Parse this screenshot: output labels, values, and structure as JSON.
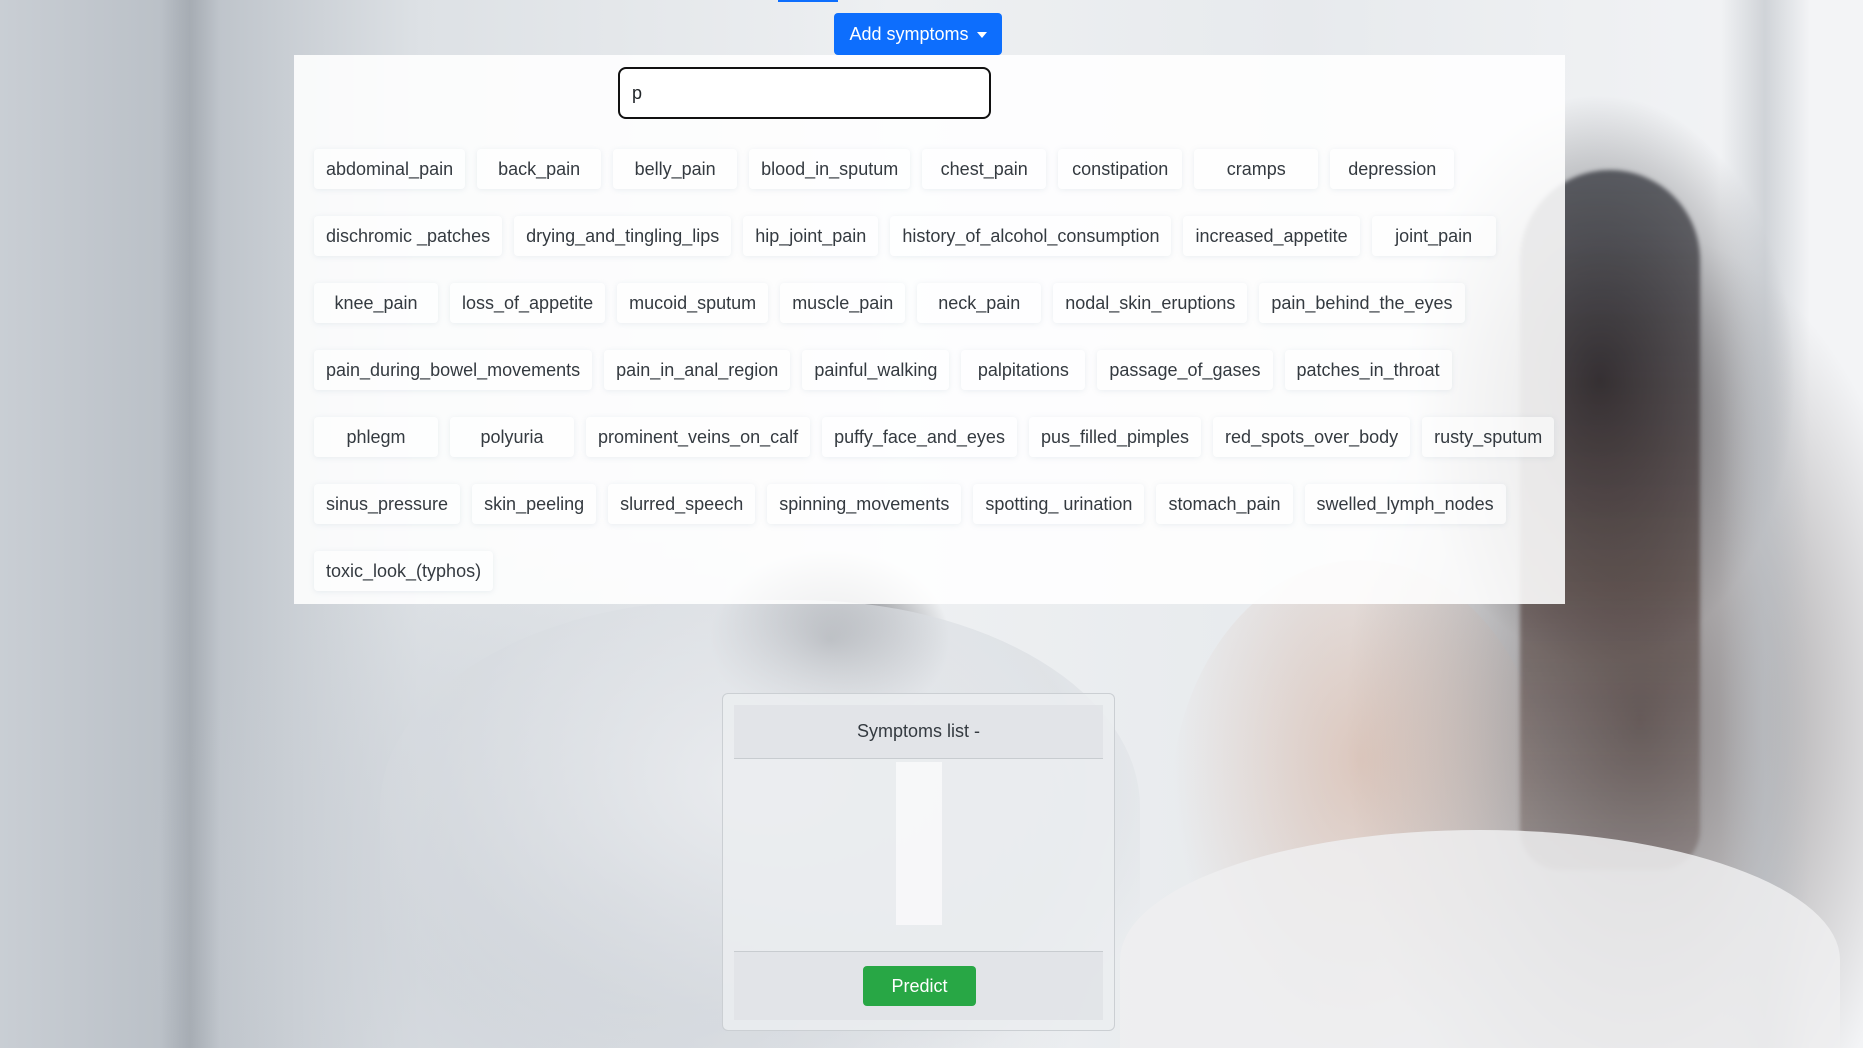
{
  "dropdown": {
    "toggle_label": "Add symptoms",
    "search_value": "p",
    "search_placeholder": "",
    "chip_rows": [
      [
        "abdominal_pain",
        "back_pain",
        "belly_pain",
        "blood_in_sputum",
        "chest_pain",
        "constipation",
        "cramps",
        "depression"
      ],
      [
        "dischromic _patches",
        "drying_and_tingling_lips",
        "hip_joint_pain",
        "history_of_alcohol_consumption",
        "increased_appetite",
        "joint_pain"
      ],
      [
        "knee_pain",
        "loss_of_appetite",
        "mucoid_sputum",
        "muscle_pain",
        "neck_pain",
        "nodal_skin_eruptions",
        "pain_behind_the_eyes"
      ],
      [
        "pain_during_bowel_movements",
        "pain_in_anal_region",
        "painful_walking",
        "palpitations",
        "passage_of_gases",
        "patches_in_throat"
      ],
      [
        "phlegm",
        "polyuria",
        "prominent_veins_on_calf",
        "puffy_face_and_eyes",
        "pus_filled_pimples",
        "red_spots_over_body",
        "rusty_sputum"
      ],
      [
        "sinus_pressure",
        "skin_peeling",
        "slurred_speech",
        "spinning_movements",
        "spotting_ urination",
        "stomach_pain",
        "swelled_lymph_nodes"
      ],
      [
        "toxic_look_(typhos)"
      ]
    ]
  },
  "symptoms_card": {
    "header": "Symptoms list -",
    "predict_label": "Predict"
  },
  "colors": {
    "primary": "#0d6efd",
    "success": "#28a745"
  }
}
